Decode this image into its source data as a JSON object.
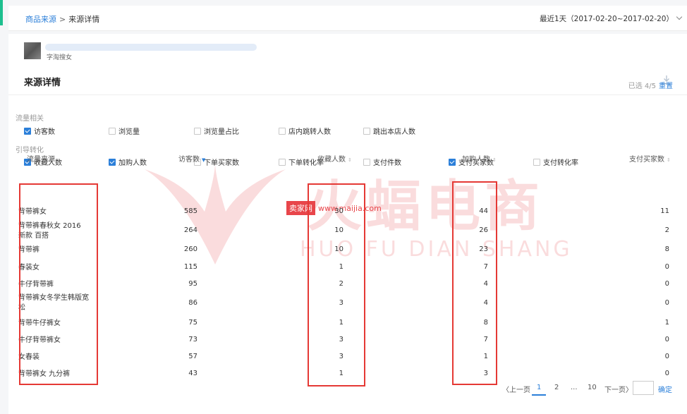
{
  "breadcrumb": {
    "parent": "商品来源",
    "separator": ">",
    "current": "来源详情"
  },
  "date_range": "最近1天（2017-02-20~2017-02-20）",
  "shop": {
    "name": "字淘搜女"
  },
  "section": {
    "title": "来源详情"
  },
  "filters": {
    "group1_label": "流量相关",
    "group1": [
      {
        "label": "访客数",
        "checked": true
      },
      {
        "label": "浏览量",
        "checked": false
      },
      {
        "label": "浏览量占比",
        "checked": false
      },
      {
        "label": "店内跳转人数",
        "checked": false
      },
      {
        "label": "跳出本店人数",
        "checked": false
      }
    ],
    "group2_label": "引导转化",
    "group2": [
      {
        "label": "收藏人数",
        "checked": true
      },
      {
        "label": "加购人数",
        "checked": true
      },
      {
        "label": "下单买家数",
        "checked": false
      },
      {
        "label": "下单转化率",
        "checked": false
      },
      {
        "label": "支付件数",
        "checked": false
      },
      {
        "label": "支付买家数",
        "checked": true
      },
      {
        "label": "支付转化率",
        "checked": false
      }
    ],
    "selected_text": "已选 4/5",
    "reset_label": "重置"
  },
  "table": {
    "headers": [
      "流量来源",
      "访客数",
      "收藏人数",
      "加购人数",
      "支付买家数"
    ],
    "rows": [
      {
        "source": "背带裤女",
        "visitors": "585",
        "favorites": "30",
        "carts": "44",
        "buyers": "11"
      },
      {
        "source": "背带裤春秋女 2016 新款 百搭",
        "visitors": "264",
        "favorites": "10",
        "carts": "26",
        "buyers": "2"
      },
      {
        "source": "背带裤",
        "visitors": "260",
        "favorites": "10",
        "carts": "23",
        "buyers": "8"
      },
      {
        "source": "春装女",
        "visitors": "115",
        "favorites": "1",
        "carts": "7",
        "buyers": "0"
      },
      {
        "source": "牛仔背带裤",
        "visitors": "95",
        "favorites": "2",
        "carts": "4",
        "buyers": "0"
      },
      {
        "source": "背带裤女冬学生韩版宽松",
        "visitors": "86",
        "favorites": "3",
        "carts": "4",
        "buyers": "0"
      },
      {
        "source": "背带牛仔裤女",
        "visitors": "75",
        "favorites": "1",
        "carts": "8",
        "buyers": "1"
      },
      {
        "source": "牛仔背带裤女",
        "visitors": "73",
        "favorites": "3",
        "carts": "7",
        "buyers": "0"
      },
      {
        "source": "女春装",
        "visitors": "57",
        "favorites": "3",
        "carts": "1",
        "buyers": "0"
      },
      {
        "source": "背带裤女 九分裤",
        "visitors": "43",
        "favorites": "1",
        "carts": "3",
        "buyers": "0"
      }
    ]
  },
  "watermark": {
    "title": "火蝠电商",
    "subtitle": "HUO FU DIAN SHANG",
    "tag": "卖家网",
    "url": "www.maijia.com"
  },
  "pagination": {
    "prev": "〈上一页",
    "pages": [
      "1",
      "2",
      "...",
      "10"
    ],
    "current": "1",
    "next": "下一页〉",
    "confirm": "确定"
  },
  "colors": {
    "accent": "#2b7fd9",
    "highlight_box": "#e53935",
    "watermark": "#e8454a",
    "left_accent": "#1dbf8f"
  }
}
